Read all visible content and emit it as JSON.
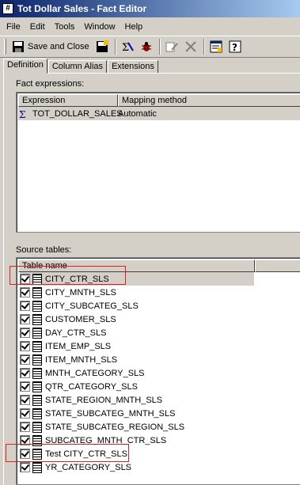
{
  "window": {
    "title": "Tot Dollar Sales - Fact Editor",
    "icon": "#"
  },
  "menu": [
    "File",
    "Edit",
    "Tools",
    "Window",
    "Help"
  ],
  "toolbar": {
    "save_close_label": "Save and Close"
  },
  "tabs": [
    "Definition",
    "Column Alias",
    "Extensions"
  ],
  "fact_expressions": {
    "label": "Fact expressions:",
    "columns": [
      "Expression",
      "Mapping method"
    ],
    "rows": [
      {
        "expression": "TOT_DOLLAR_SALES",
        "mapping": "Automatic"
      }
    ]
  },
  "source_tables": {
    "label": "Source tables:",
    "column": "Table name",
    "rows": [
      "CITY_CTR_SLS",
      "CITY_MNTH_SLS",
      "CITY_SUBCATEG_SLS",
      "CUSTOMER_SLS",
      "DAY_CTR_SLS",
      "ITEM_EMP_SLS",
      "ITEM_MNTH_SLS",
      "MNTH_CATEGORY_SLS",
      "QTR_CATEGORY_SLS",
      "STATE_REGION_MNTH_SLS",
      "STATE_SUBCATEG_MNTH_SLS",
      "STATE_SUBCATEG_REGION_SLS",
      "SUBCATEG_MNTH_CTR_SLS",
      "Test CITY_CTR_SLS",
      "YR_CATEGORY_SLS"
    ]
  },
  "colors": {
    "title_start": "#0a246a",
    "title_end": "#a6caf0",
    "highlight_box": "#e02020",
    "face": "#d4d0c8"
  }
}
